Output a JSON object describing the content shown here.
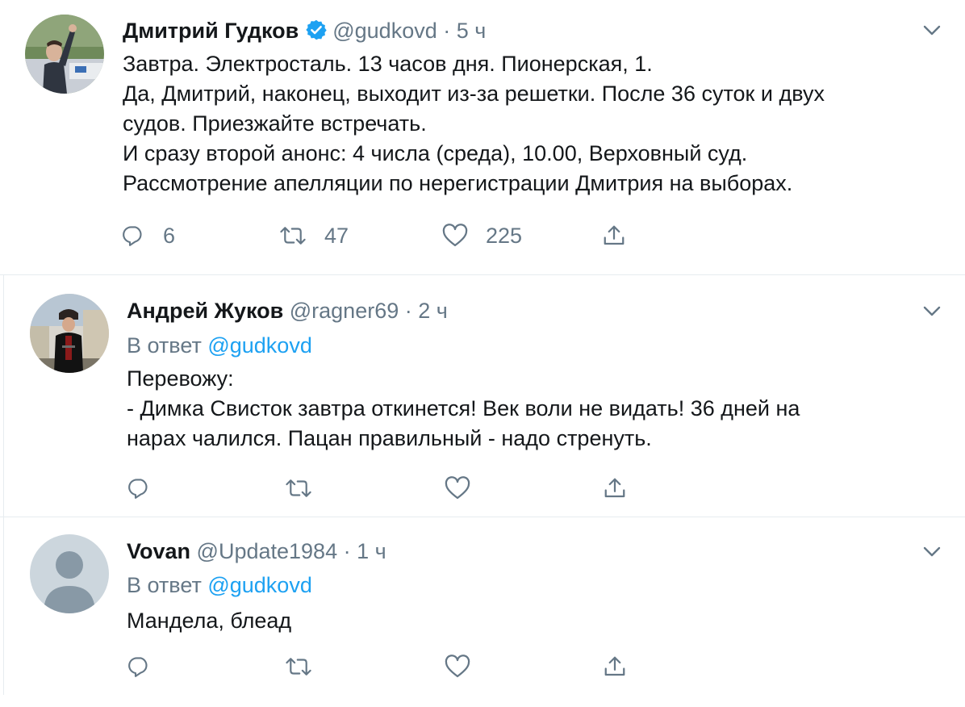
{
  "tweets": [
    {
      "author_name": "Дмитрий Гудков",
      "verified": true,
      "handle": "@gudkovd",
      "separator": "·",
      "time": "5 ч",
      "body_lines": [
        "Завтра. Электросталь. 13 часов дня. Пионерская, 1.",
        "Да, Дмитрий, наконец, выходит из-за решетки. После 36 суток и двух",
        "судов. Приезжайте встречать.",
        "И сразу второй анонс: 4 числа (среда), 10.00, Верховный суд.",
        "Рассмотрение апелляции по нерегистрации Дмитрия на выборах."
      ],
      "replies": "6",
      "retweets": "47",
      "likes": "225"
    },
    {
      "author_name": "Андрей Жуков",
      "handle": "@ragner69",
      "separator": "·",
      "time": "2 ч",
      "replying_prefix": "В ответ",
      "replying_to": "@gudkovd",
      "body_lines": [
        "Перевожу:",
        "- Димка Свисток завтра откинется! Век воли не видать! 36 дней на",
        "нарах чалился. Пацан правильный - надо стренуть."
      ]
    },
    {
      "author_name": "Vovan",
      "handle": "@Update1984",
      "separator": "·",
      "time": "1 ч",
      "replying_prefix": "В ответ",
      "replying_to": "@gudkovd",
      "body_lines": [
        "Мандела, блеад"
      ]
    }
  ],
  "colors": {
    "text": "#14171a",
    "secondary": "#657786",
    "accent": "#1da1f2",
    "divider": "#e6ecf0"
  },
  "icons": [
    "reply-icon",
    "retweet-icon",
    "like-icon",
    "share-icon",
    "chevron-down-icon",
    "verified-badge-icon"
  ]
}
